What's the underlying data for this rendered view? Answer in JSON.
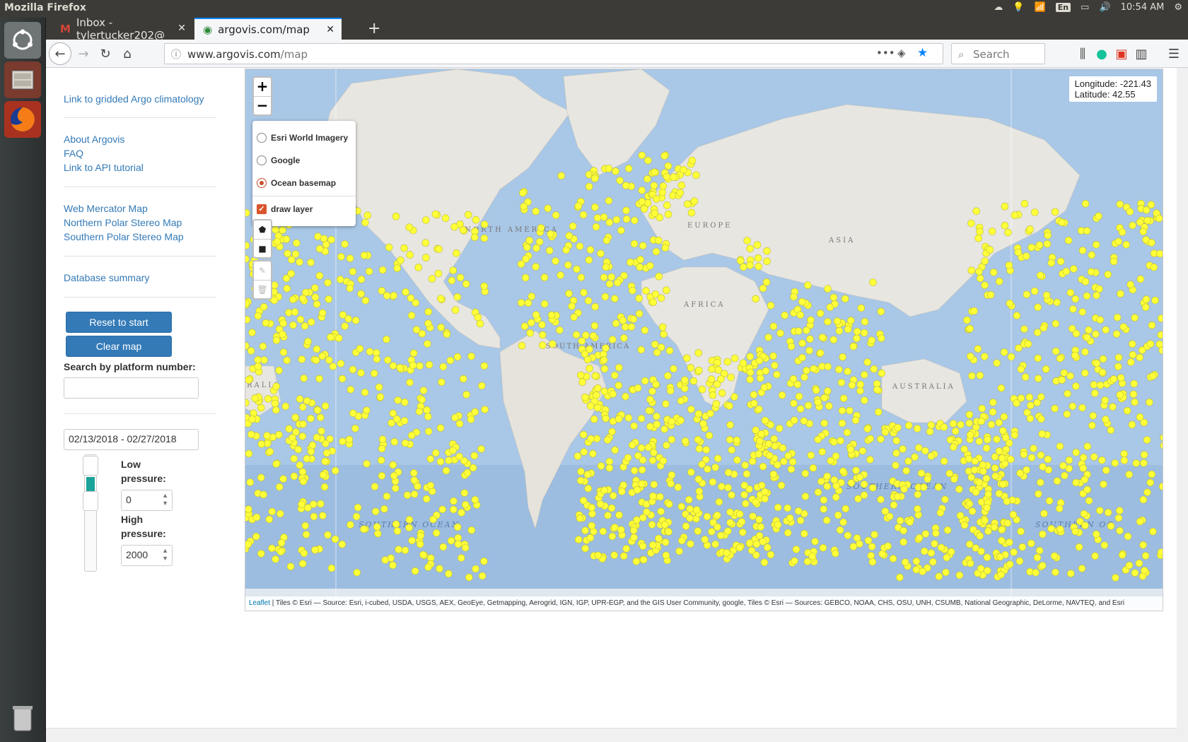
{
  "os": {
    "window_title": "Mozilla Firefox",
    "keyboard": "En",
    "clock": "10:54 AM"
  },
  "browser": {
    "tabs": [
      {
        "label": "Inbox - tylertucker202@"
      },
      {
        "label": "argovis.com/map"
      }
    ],
    "url_host": "www.argovis.com",
    "url_path": "/map",
    "search_placeholder": "Search"
  },
  "sidebar": {
    "climatology_link": "Link to gridded Argo climatology",
    "about_link": "About Argovis",
    "faq_link": "FAQ",
    "api_link": "Link to API tutorial",
    "mercator_link": "Web Mercator Map",
    "north_polar_link": "Northern Polar Stereo Map",
    "south_polar_link": "Southern Polar Stereo Map",
    "db_summary_link": "Database summary",
    "reset_button": "Reset to start",
    "clear_button": "Clear map",
    "platform_search_label": "Search by platform number:",
    "platform_search_value": "",
    "date_range": "02/13/2018 - 02/27/2018",
    "low_pressure_label": "Low pressure:",
    "low_pressure_value": "0",
    "high_pressure_label": "High pressure:",
    "high_pressure_value": "2000"
  },
  "map": {
    "zoom_in": "+",
    "zoom_out": "−",
    "layers": [
      {
        "label": "Esri World Imagery",
        "selected": false
      },
      {
        "label": "Google",
        "selected": false
      },
      {
        "label": "Ocean basemap",
        "selected": true
      }
    ],
    "draw_layer_label": "draw layer",
    "longitude_text": "Longitude: -221.43",
    "latitude_text": "Latitude: 42.55",
    "labels": {
      "north_america": "NORTH AMERICA",
      "europe": "EUROPE",
      "asia": "ASIA",
      "africa": "AFRICA",
      "south_america": "SOUTH AMERICA",
      "australia": "AUSTRALIA",
      "australia_left": "RALIA",
      "southern_ocean_1": "SOUTHERN OCEAN",
      "southern_ocean_2": "SOUTHERN OCEAN",
      "southern_ocean_3": "SOUTHERN OC"
    },
    "attribution_link": "Leaflet",
    "attribution_text": " | Tiles © Esri — Source: Esri, i-cubed, USDA, USGS, AEX, GeoEye, Getmapping, Aerogrid, IGN, IGP, UPR-EGP, and the GIS User Community, google, Tiles © Esri — Sources: GEBCO, NOAA, CHS, OSU, UNH, CSUMB, National Geographic, DeLorme, NAVTEQ, and Esri",
    "colors": {
      "ocean": "#a6c5e6",
      "land": "#e8e6e1",
      "float_marker": "#ffff3a"
    }
  }
}
